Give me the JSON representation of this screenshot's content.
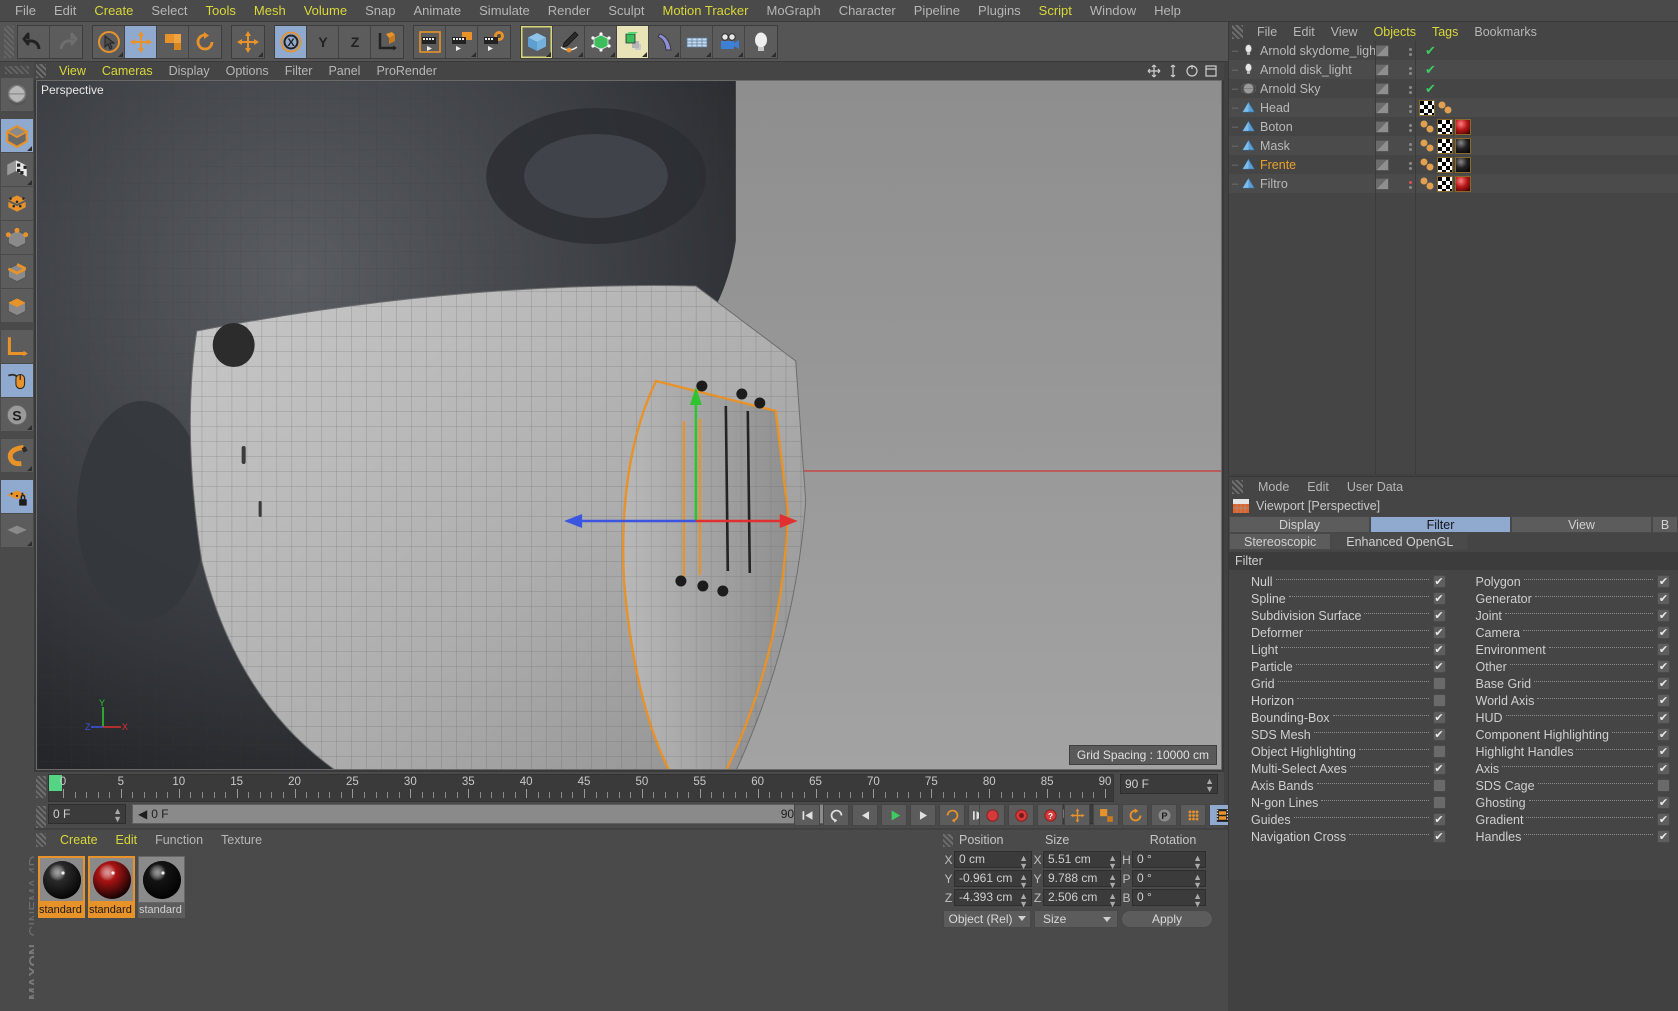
{
  "menubar": {
    "items": [
      {
        "label": "File",
        "hl": false
      },
      {
        "label": "Edit",
        "hl": false
      },
      {
        "label": "Create",
        "hl": true
      },
      {
        "label": "Select",
        "hl": false
      },
      {
        "label": "Tools",
        "hl": true
      },
      {
        "label": "Mesh",
        "hl": true
      },
      {
        "label": "Volume",
        "hl": true
      },
      {
        "label": "Snap",
        "hl": false
      },
      {
        "label": "Animate",
        "hl": false
      },
      {
        "label": "Simulate",
        "hl": false
      },
      {
        "label": "Render",
        "hl": false
      },
      {
        "label": "Sculpt",
        "hl": false
      },
      {
        "label": "Motion Tracker",
        "hl": true
      },
      {
        "label": "MoGraph",
        "hl": false
      },
      {
        "label": "Character",
        "hl": false
      },
      {
        "label": "Pipeline",
        "hl": false
      },
      {
        "label": "Plugins",
        "hl": false
      },
      {
        "label": "Script",
        "hl": true
      },
      {
        "label": "Window",
        "hl": false
      },
      {
        "label": "Help",
        "hl": false
      }
    ]
  },
  "toolbar": {
    "groups": [
      {
        "name": "undo-redo",
        "buttons": [
          {
            "icon": "undo-icon",
            "selected": false,
            "corner": false
          },
          {
            "icon": "redo-icon",
            "selected": false,
            "corner": false
          }
        ]
      },
      {
        "name": "transform-tools",
        "buttons": [
          {
            "icon": "live-selection-icon",
            "selected": false,
            "corner": true
          },
          {
            "icon": "move-icon",
            "selected": true,
            "corner": false
          },
          {
            "icon": "scale-icon",
            "selected": false,
            "corner": false
          },
          {
            "icon": "rotate-icon",
            "selected": false,
            "corner": false
          }
        ]
      },
      {
        "name": "axis-modify",
        "buttons": [
          {
            "icon": "move-axis-icon",
            "selected": false,
            "corner": true
          }
        ]
      },
      {
        "name": "axis-lock",
        "buttons": [
          {
            "icon": "x-axis-icon",
            "selected": true,
            "corner": false
          },
          {
            "icon": "y-axis-icon",
            "selected": false,
            "corner": false
          },
          {
            "icon": "z-axis-icon",
            "selected": false,
            "corner": false
          },
          {
            "icon": "world-object-axis-icon",
            "selected": false,
            "corner": false
          }
        ]
      },
      {
        "name": "render-tools",
        "buttons": [
          {
            "icon": "render-view-icon",
            "selected": false,
            "corner": false
          },
          {
            "icon": "render-to-picture-viewer-icon",
            "selected": false,
            "corner": true
          },
          {
            "icon": "render-settings-icon",
            "selected": false,
            "corner": false
          }
        ]
      },
      {
        "name": "create-objects",
        "buttons": [
          {
            "icon": "cube-primitive-icon",
            "selected": false,
            "corner": true,
            "outlined": true
          },
          {
            "icon": "spline-pen-icon",
            "selected": false,
            "corner": true
          },
          {
            "icon": "nurbs-generator-icon",
            "selected": false,
            "corner": true
          },
          {
            "icon": "array-cloner-icon",
            "selected": true,
            "corner": true
          },
          {
            "icon": "deformer-icon",
            "selected": false,
            "corner": true
          },
          {
            "icon": "floor-scene-icon",
            "selected": false,
            "corner": true
          },
          {
            "icon": "camera-icon",
            "selected": false,
            "corner": true
          },
          {
            "icon": "light-icon",
            "selected": false,
            "corner": true
          }
        ]
      }
    ]
  },
  "lefttoolbar": {
    "buttons": [
      {
        "icon": "globe-undo-icon",
        "selected": false,
        "corner": false
      },
      {
        "icon": "model-mode-icon",
        "selected": true,
        "corner": true
      },
      {
        "icon": "texture-mode-icon",
        "selected": false,
        "corner": true
      },
      {
        "icon": "points-mode-icon",
        "selected": false,
        "corner": false
      },
      {
        "icon": "point-mode-icon",
        "selected": false,
        "corner": false
      },
      {
        "icon": "edge-mode-icon",
        "selected": false,
        "corner": false
      },
      {
        "icon": "polygon-mode-icon",
        "selected": false,
        "corner": false
      },
      {
        "icon": "object-axis-icon",
        "selected": false,
        "corner": false
      },
      {
        "icon": "viewport-solo-icon",
        "selected": true,
        "corner": false
      },
      {
        "icon": "s-workplane-icon",
        "selected": false,
        "corner": true
      },
      {
        "icon": "magnet-icon",
        "selected": false,
        "corner": true
      },
      {
        "icon": "lock-workplane-icon",
        "selected": true,
        "corner": false
      },
      {
        "icon": "workplane-icon",
        "selected": false,
        "corner": true
      }
    ]
  },
  "viewport": {
    "menu": [
      {
        "label": "View",
        "hl": true
      },
      {
        "label": "Cameras",
        "hl": true
      },
      {
        "label": "Display",
        "hl": false
      },
      {
        "label": "Options",
        "hl": false
      },
      {
        "label": "Filter",
        "hl": false
      },
      {
        "label": "Panel",
        "hl": false
      },
      {
        "label": "ProRender",
        "hl": false
      }
    ],
    "label": "Perspective",
    "grid_spacing": "Grid Spacing : 10000 cm",
    "axis_labels": {
      "x": "X",
      "y": "Y",
      "z": "Z"
    },
    "colors": {
      "x_axis": "#d02a2a",
      "y_axis": "#2ad02a",
      "z_axis": "#2a50d0",
      "selection_outline": "#e8922a"
    }
  },
  "timeline": {
    "ticks": [
      0,
      5,
      10,
      15,
      20,
      25,
      30,
      35,
      40,
      45,
      50,
      55,
      60,
      65,
      70,
      75,
      80,
      85,
      90
    ],
    "start_frame": "0 F",
    "current_frame": "0 F",
    "preview_min": "0 F",
    "preview_max": "90 F",
    "end_field": "90 F",
    "transport": [
      "go-to-start-icon",
      "play-reverse-icon",
      "step-back-icon",
      "play-icon",
      "step-forward-icon",
      "loop-icon",
      "go-to-end-icon"
    ],
    "record_buttons": [
      "record-active-object-icon",
      "autokeying-icon",
      "keyframe-selection-icon"
    ],
    "key_buttons": [
      "position-key-icon",
      "scale-key-icon",
      "rotation-key-icon",
      "param-key-icon",
      "point-level-key-icon",
      "timeline-icon"
    ]
  },
  "materials": {
    "menu": [
      {
        "label": "Create",
        "hl": true
      },
      {
        "label": "Edit",
        "hl": true
      },
      {
        "label": "Function",
        "hl": false
      },
      {
        "label": "Texture",
        "hl": false
      }
    ],
    "items": [
      {
        "name": "standard",
        "color": "#2a2a2a",
        "selected": true
      },
      {
        "name": "standard",
        "color": "#aa1414",
        "selected": true
      },
      {
        "name": "standard",
        "color": "#141414",
        "selected": false
      }
    ]
  },
  "brand": {
    "line1": "MAXON",
    "line2": "CINEMA 4D"
  },
  "object_manager": {
    "menu": [
      {
        "label": "File",
        "hl": false
      },
      {
        "label": "Edit",
        "hl": false
      },
      {
        "label": "View",
        "hl": false
      },
      {
        "label": "Objects",
        "hl": true
      },
      {
        "label": "Tags",
        "hl": true
      },
      {
        "label": "Bookmarks",
        "hl": false
      }
    ],
    "objects": [
      {
        "name": "Arnold skydome_light",
        "icon": "light-object-icon",
        "visible": true,
        "check": true,
        "dot": "none",
        "tags": []
      },
      {
        "name": "Arnold disk_light",
        "icon": "light-object-icon",
        "visible": true,
        "check": true,
        "dot": "none",
        "tags": []
      },
      {
        "name": "Arnold Sky",
        "icon": "sky-object-icon",
        "visible": true,
        "check": true,
        "dot": "none",
        "tags": []
      },
      {
        "name": "Head",
        "icon": "polygon-object-icon",
        "visible": true,
        "check": false,
        "dot": "none",
        "tags": [
          "checker-tag",
          "phong-tag"
        ]
      },
      {
        "name": "Boton",
        "icon": "polygon-object-icon",
        "visible": true,
        "check": false,
        "dot": "none",
        "tags": [
          "phong-tag",
          "checker-tag",
          "material-red-tag"
        ]
      },
      {
        "name": "Mask",
        "icon": "polygon-object-icon",
        "visible": true,
        "check": false,
        "dot": "none",
        "tags": [
          "phong-tag",
          "checker-tag",
          "material-black-tag"
        ]
      },
      {
        "name": "Frente",
        "icon": "polygon-object-icon",
        "visible": true,
        "check": false,
        "dot": "none",
        "tags": [
          "phong-tag",
          "checker-tag",
          "material-black-tag"
        ],
        "selected": true
      },
      {
        "name": "Filtro",
        "icon": "polygon-object-icon",
        "visible": true,
        "check": false,
        "dot": "red",
        "tags": [
          "phong-tag",
          "checker-tag",
          "material-red-tag"
        ]
      }
    ]
  },
  "attribute_manager": {
    "menu": [
      {
        "label": "Mode"
      },
      {
        "label": "Edit"
      },
      {
        "label": "User Data"
      }
    ],
    "title": "Viewport [Perspective]",
    "tabs": [
      {
        "label": "Display",
        "active": false
      },
      {
        "label": "Filter",
        "active": true
      },
      {
        "label": "View",
        "active": false
      },
      {
        "label": "B",
        "active": false
      }
    ],
    "tabs_row2": [
      {
        "label": "Stereoscopic",
        "active": false
      },
      {
        "label": "Enhanced OpenGL",
        "active": false
      }
    ],
    "section_title": "Filter",
    "filters_left": [
      {
        "label": "Null",
        "checked": true
      },
      {
        "label": "Spline",
        "checked": true
      },
      {
        "label": "Subdivision Surface",
        "checked": true
      },
      {
        "label": "Deformer",
        "checked": true
      },
      {
        "label": "Light",
        "checked": true
      },
      {
        "label": "Particle",
        "checked": true
      },
      {
        "label": "Grid",
        "checked": false
      },
      {
        "label": "Horizon",
        "checked": false
      },
      {
        "label": "Bounding-Box",
        "checked": true
      },
      {
        "label": "SDS Mesh",
        "checked": true
      },
      {
        "label": "Object Highlighting",
        "checked": false
      },
      {
        "label": "Multi-Select Axes",
        "checked": true
      },
      {
        "label": "Axis Bands",
        "checked": false
      },
      {
        "label": "N-gon Lines",
        "checked": false
      },
      {
        "label": "Guides",
        "checked": true
      },
      {
        "label": "Navigation Cross",
        "checked": true
      }
    ],
    "filters_right": [
      {
        "label": "Polygon",
        "checked": true
      },
      {
        "label": "Generator",
        "checked": true
      },
      {
        "label": "Joint",
        "checked": true
      },
      {
        "label": "Camera",
        "checked": true
      },
      {
        "label": "Environment",
        "checked": true
      },
      {
        "label": "Other",
        "checked": true
      },
      {
        "label": "Base Grid",
        "checked": true
      },
      {
        "label": "World Axis",
        "checked": true
      },
      {
        "label": "HUD",
        "checked": true
      },
      {
        "label": "Component Highlighting",
        "checked": true
      },
      {
        "label": "Highlight Handles",
        "checked": true
      },
      {
        "label": "Axis",
        "checked": true
      },
      {
        "label": "SDS Cage",
        "checked": false
      },
      {
        "label": "Ghosting",
        "checked": true
      },
      {
        "label": "Gradient",
        "checked": true
      },
      {
        "label": "Handles",
        "checked": true
      }
    ]
  },
  "coordinates": {
    "headers": {
      "position": "Position",
      "size": "Size",
      "rotation": "Rotation"
    },
    "rows": [
      {
        "axis": "X",
        "position": "0 cm",
        "size_axis": "X",
        "size": "5.51 cm",
        "rot_axis": "H",
        "rotation": "0 °"
      },
      {
        "axis": "Y",
        "position": "-0.961 cm",
        "size_axis": "Y",
        "size": "9.788 cm",
        "rot_axis": "P",
        "rotation": "0 °"
      },
      {
        "axis": "Z",
        "position": "-4.393 cm",
        "size_axis": "Z",
        "size": "2.506 cm",
        "rot_axis": "B",
        "rotation": "0 °"
      }
    ],
    "mode_dropdown": "Object (Rel)",
    "size_dropdown": "Size",
    "apply_button": "Apply"
  }
}
